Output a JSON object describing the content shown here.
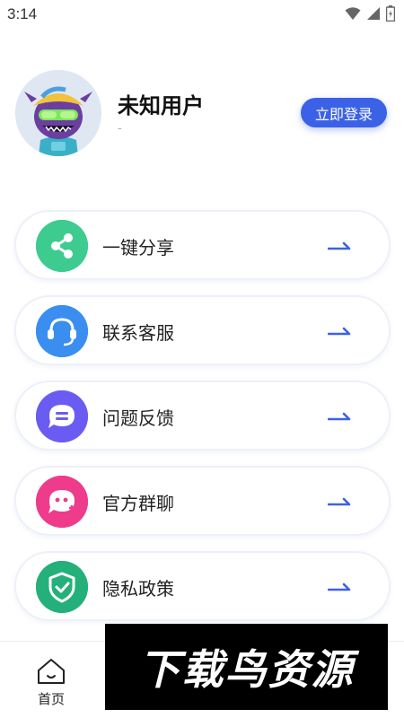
{
  "status_bar": {
    "time": "3:14"
  },
  "profile": {
    "username": "未知用户",
    "subtitle": "-",
    "login_button": "立即登录"
  },
  "menu": {
    "items": [
      {
        "label": "一键分享",
        "icon": "share-icon",
        "color": "#3ecb8f"
      },
      {
        "label": "联系客服",
        "icon": "headset-icon",
        "color": "#3a8ef0"
      },
      {
        "label": "问题反馈",
        "icon": "feedback-icon",
        "color": "#6a5cf2"
      },
      {
        "label": "官方群聊",
        "icon": "group-chat-icon",
        "color": "#ee3b8c"
      },
      {
        "label": "隐私政策",
        "icon": "shield-check-icon",
        "color": "#24b07a"
      }
    ]
  },
  "bottom_nav": {
    "home_label": "首页"
  },
  "watermark": {
    "text": "下载鸟资源"
  },
  "colors": {
    "accent": "#3b62e6",
    "arrow": "#3b62e6"
  }
}
